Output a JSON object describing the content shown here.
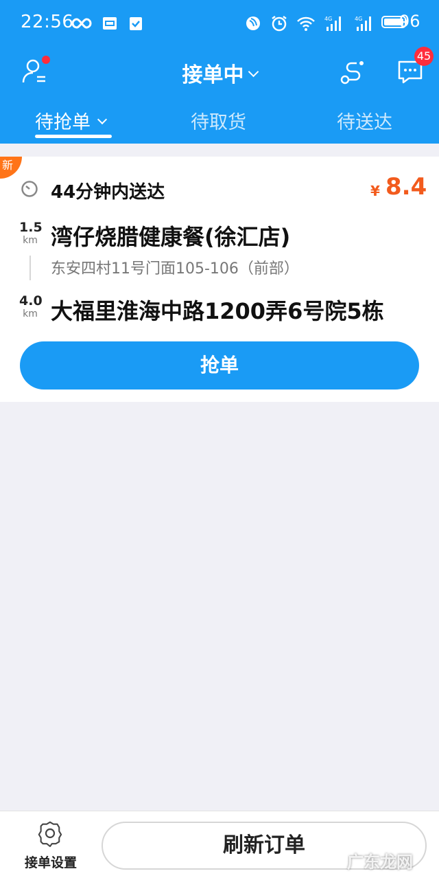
{
  "status_bar": {
    "time": "22:56",
    "battery": "96",
    "notif_icons": [
      "infinity-icon",
      "toutiao-icon",
      "task-icon"
    ],
    "system_icons": [
      "nfc-icon",
      "alarm-icon",
      "wifi-icon",
      "signal-4g-icon",
      "signal-4g-icon"
    ]
  },
  "nav": {
    "title": "接单中",
    "msg_badge": "45"
  },
  "tabs": [
    {
      "label": "待抢单",
      "active": true
    },
    {
      "label": "待取货",
      "active": false
    },
    {
      "label": "待送达",
      "active": false
    }
  ],
  "order": {
    "new_tag": "新",
    "deliver_time": "44分钟内送达",
    "price_symbol": "¥",
    "price": "8.4",
    "pickup": {
      "distance": "1.5",
      "unit": "km",
      "name": "湾仔烧腊健康餐(徐汇店)",
      "address": "东安四村11号门面105-106（前部）"
    },
    "dropoff": {
      "distance": "4.0",
      "unit": "km",
      "address": "大福里淮海中路1200弄6号院5栋"
    },
    "grab_label": "抢单"
  },
  "bottom": {
    "settings_label": "接单设置",
    "refresh_label": "刷新订单",
    "watermark": "广东龙网"
  },
  "colors": {
    "primary": "#1a9bf5",
    "price": "#f25b1d",
    "badge": "#ff2d3c",
    "new_tag": "#ff7418",
    "background": "#f0f0f6"
  }
}
